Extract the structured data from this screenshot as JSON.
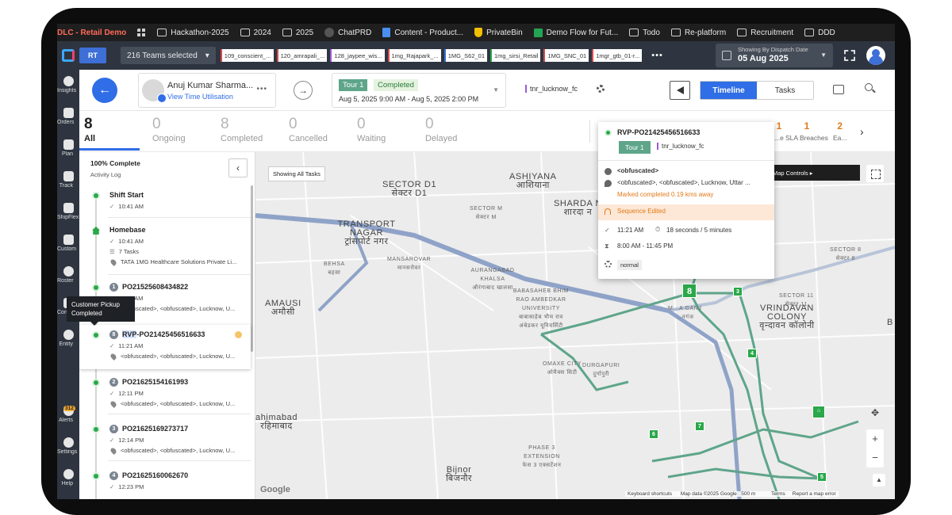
{
  "bookmarks": [
    {
      "label": "DLC - Retail Demo",
      "icon": "brand"
    },
    {
      "label": "",
      "icon": "grid-icon"
    },
    {
      "label": "Hackathon-2025",
      "icon": "folder-icon"
    },
    {
      "label": "2024",
      "icon": "folder-icon"
    },
    {
      "label": "2025",
      "icon": "folder-icon"
    },
    {
      "label": "ChatPRD",
      "icon": "chat-icon"
    },
    {
      "label": "Content - Product...",
      "icon": "doc-icon"
    },
    {
      "label": "PrivateBin",
      "icon": "shield-icon"
    },
    {
      "label": "Demo Flow for Fut...",
      "icon": "sheet-icon"
    },
    {
      "label": "Todo",
      "icon": "folder-icon"
    },
    {
      "label": "Re-platform",
      "icon": "folder-icon"
    },
    {
      "label": "Recruitment",
      "icon": "folder-icon"
    },
    {
      "label": "DDD",
      "icon": "folder-icon"
    }
  ],
  "appbar": {
    "rt_label": "RT",
    "teams_selected": "216 Teams selected",
    "chips": [
      {
        "label": "109_conscient_...",
        "color": "#d94a4a"
      },
      {
        "label": "120_amrapali_...",
        "color": "#d94a4a"
      },
      {
        "label": "128_jaypee_wis...",
        "color": "#9b59d6"
      },
      {
        "label": "1mg_Rajapark_...",
        "color": "#d94a4a"
      },
      {
        "label": "1MG_S62_01",
        "color": "#3d6fd6"
      },
      {
        "label": "1mg_sirsi_Retail",
        "color": "#2aa84a"
      },
      {
        "label": "1MG_SNC_01",
        "color": "#d94a4a"
      },
      {
        "label": "1mgr_gtb_01-r...",
        "color": "#d94a4a"
      }
    ],
    "more_label": "•••",
    "dispatch_label": "Showing By Dispatch Date",
    "dispatch_date": "05 Aug 2025"
  },
  "leftnav": [
    {
      "label": "Insights",
      "icon": "insights-icon"
    },
    {
      "label": "Orders",
      "icon": "orders-icon"
    },
    {
      "label": "Plan",
      "icon": "calendar-icon"
    },
    {
      "label": "Track",
      "icon": "track-icon"
    },
    {
      "label": "ShipFlex",
      "icon": "truck-icon"
    },
    {
      "label": "Custom",
      "icon": "custom-icon"
    },
    {
      "label": "Roster",
      "icon": "gear-icon"
    },
    {
      "label": "Contra",
      "icon": "contract-icon"
    },
    {
      "label": "Entity",
      "icon": "database-icon"
    },
    {
      "label": "Alerts",
      "icon": "alerts-icon",
      "badge": "312"
    },
    {
      "label": "Settings",
      "icon": "settings-icon"
    },
    {
      "label": "Help",
      "icon": "help-icon"
    }
  ],
  "tour_header": {
    "agent_name": "Anuj Kumar Sharma...",
    "agent_link": "View Time Utilisation",
    "more": "•••",
    "tour_tag": "Tour 1",
    "tour_status": "Completed",
    "tour_time": "Aug 5, 2025 9:00 AM - Aug 5, 2025 2:00 PM",
    "hub": "tnr_lucknow_fc",
    "tabs": [
      "Timeline",
      "Tasks"
    ]
  },
  "stats": [
    {
      "count": "8",
      "label": "All"
    },
    {
      "count": "0",
      "label": "Ongoing"
    },
    {
      "count": "8",
      "label": "Completed"
    },
    {
      "count": "0",
      "label": "Cancelled"
    },
    {
      "count": "0",
      "label": "Waiting"
    },
    {
      "count": "0",
      "label": "Delayed"
    }
  ],
  "sla": [
    {
      "count": "1",
      "label": "...e"
    },
    {
      "count": "1",
      "label": "SLA Breaches"
    },
    {
      "count": "2",
      "label": "Ea..."
    }
  ],
  "timeline": {
    "progress": "100% Complete",
    "activity_log": "Activity Log",
    "tooltip": "Customer Pickup Completed",
    "events": [
      {
        "title": "Shift Start",
        "time": "10:41 AM"
      },
      {
        "title": "Homebase",
        "time": "10:41 AM",
        "tasks": "7 Tasks",
        "address": "TATA 1MG Healthcare Solutions Private Li..."
      },
      {
        "num": "1",
        "title": "PO21525608434822",
        "time": "11:09 AM",
        "address": "<obfuscated>, <obfuscated>, Lucknow, U..."
      },
      {
        "num": "8",
        "title_prefix": "RVP",
        "title": "-PO21425456516633",
        "time": "11:21 AM",
        "address": "<obfuscated>, <obfuscated>, Lucknow, U..."
      },
      {
        "num": "2",
        "title": "PO21625154161993",
        "time": "12:11 PM",
        "address": "<obfuscated>, <obfuscated>, Lucknow, U..."
      },
      {
        "num": "3",
        "title": "PO21625169273717",
        "time": "12:14 PM",
        "address": "<obfuscated>, <obfuscated>, Lucknow, U..."
      },
      {
        "num": "4",
        "title": "PO21625160062670",
        "time": "12:23 PM"
      }
    ]
  },
  "map": {
    "showing_all": "Showing All Tasks",
    "map_controls": "Map Controls",
    "places": [
      {
        "name": "SECTOR D1",
        "alt": "सेक्टर D1"
      },
      {
        "name": "ASHIYANA",
        "alt": "आशियाना"
      },
      {
        "name": "SECTOR M",
        "alt": "सेक्टर M"
      },
      {
        "name": "SHARDA N",
        "alt": "शारदा न"
      },
      {
        "name": "TRANSPORT NAGAR",
        "alt": "ट्रांसपोर्ट नगर"
      },
      {
        "name": "BEHSA",
        "alt": "बहसा"
      },
      {
        "name": "MANSAROVAR",
        "alt": "मानसरोवर"
      },
      {
        "name": "AURANGABAD KHALSA",
        "alt": "औरंगाबाद खालसा"
      },
      {
        "name": "BABASAHEB BHIM RAO AMBEDKAR UNIVERSITY",
        "alt": "बाबासाहेब भीम राव अंबेडकर यूनिवर्सिटी"
      },
      {
        "name": "AMAUSI",
        "alt": "अमौसी"
      },
      {
        "name": "M...A GANJ",
        "alt": "...नगंज"
      },
      {
        "name": "VRINDAVAN COLONY",
        "alt": "वृन्दावन कॉलोनी"
      },
      {
        "name": "SECTOR 11",
        "alt": "सेक्टर 11"
      },
      {
        "name": "SECTOR 8",
        "alt": "सेक्टर 8"
      },
      {
        "name": "OMAXE CITY",
        "alt": "ओमैक्स सिटी"
      },
      {
        "name": "DURGAPURI",
        "alt": "दुर्गापुरी"
      },
      {
        "name": "ahimabad",
        "alt": "रहिमाबाद"
      },
      {
        "name": "PHASE 3 EXTENSION",
        "alt": "फेस 3 एक्सटेंशन"
      },
      {
        "name": "Bijnor",
        "alt": "बिजनौर"
      },
      {
        "name": "B",
        "alt": ""
      }
    ],
    "stops": [
      "8",
      "3",
      "4",
      "7",
      "6",
      "5"
    ],
    "attribution": {
      "shortcuts": "Keyboard shortcuts",
      "data": "Map data ©2025 Google",
      "scale": "500 m",
      "terms": "Terms",
      "report": "Report a map error"
    },
    "google": "Google"
  },
  "popup": {
    "id": "RVP-PO21425456516633",
    "tour": "Tour 1",
    "hub": "tnr_lucknow_fc",
    "customer": "<obfuscated>",
    "address": "<obfuscated>, <obfuscated>, Lucknow, Uttar ...",
    "distance": "Marked completed 0.19 kms away",
    "sequence": "Sequence Edited",
    "time": "11:21 AM",
    "duration": "18 seconds / 5 minutes",
    "window": "8:00 AM - 11:45 PM",
    "priority": "normal"
  },
  "colors": {
    "accent": "#2f6ee6",
    "success": "#2aa84a",
    "warning": "#e07a1a",
    "tour": "#5ea58a"
  }
}
